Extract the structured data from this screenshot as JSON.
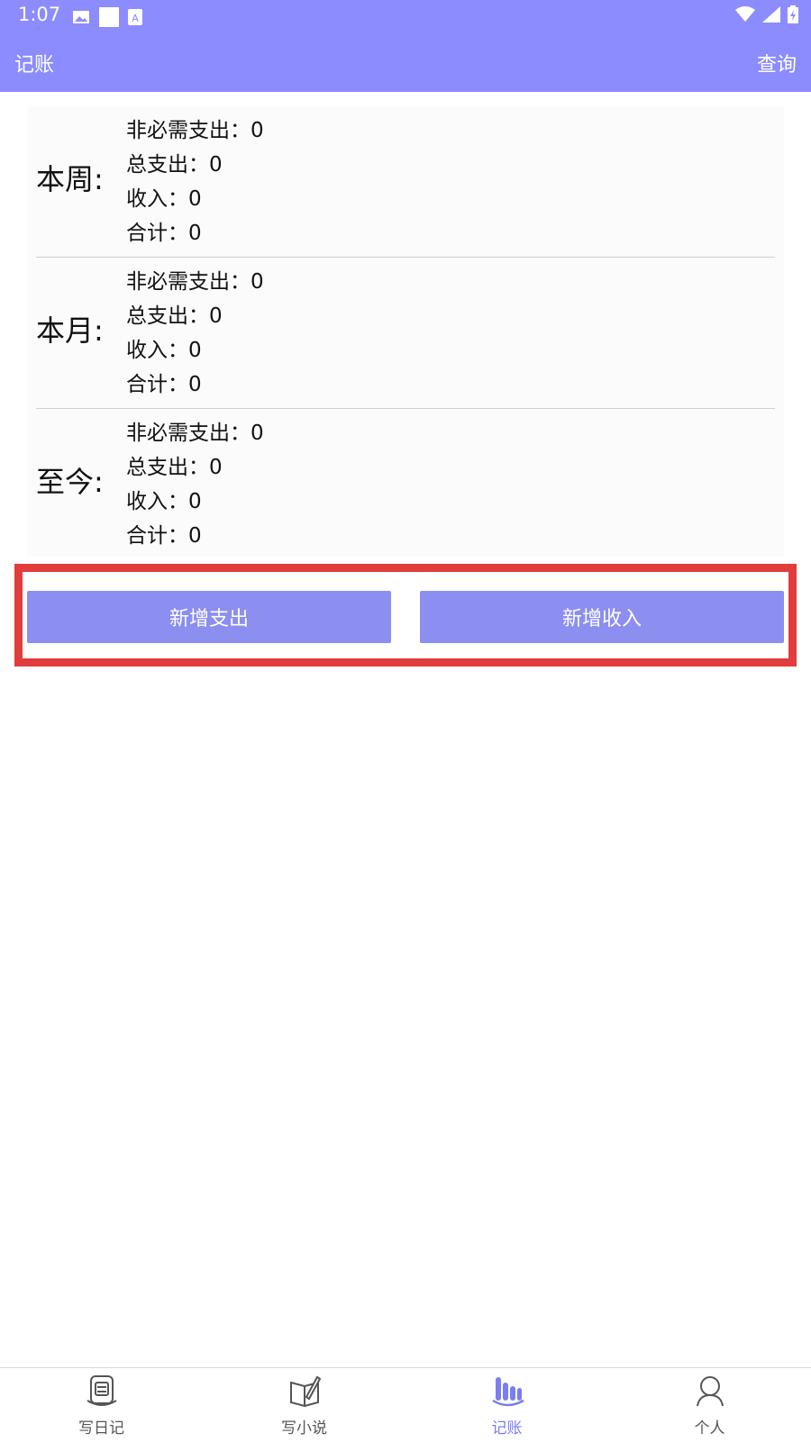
{
  "status_bar": {
    "time": "1:07"
  },
  "app_bar": {
    "title": "记账",
    "query_label": "查询"
  },
  "colors": {
    "primary": "#8c8cff",
    "button": "#8c8ef0",
    "highlight": "#e23c3c",
    "active_tab": "#7a7ef0"
  },
  "summary": [
    {
      "label": "本周:",
      "lines": [
        "非必需支出：0",
        "总支出：0",
        "收入：0",
        "合计：0"
      ]
    },
    {
      "label": "本月:",
      "lines": [
        "非必需支出：0",
        "总支出：0",
        "收入：0",
        "合计：0"
      ]
    },
    {
      "label": "至今:",
      "lines": [
        "非必需支出：0",
        "总支出：0",
        "收入：0",
        "合计：0"
      ]
    }
  ],
  "actions": {
    "add_expense": "新增支出",
    "add_income": "新增收入"
  },
  "bottom_nav": [
    {
      "label": "写日记",
      "icon": "diary-icon"
    },
    {
      "label": "写小说",
      "icon": "novel-pen-icon"
    },
    {
      "label": "记账",
      "icon": "ledger-bars-icon",
      "active": true
    },
    {
      "label": "个人",
      "icon": "person-icon"
    }
  ]
}
